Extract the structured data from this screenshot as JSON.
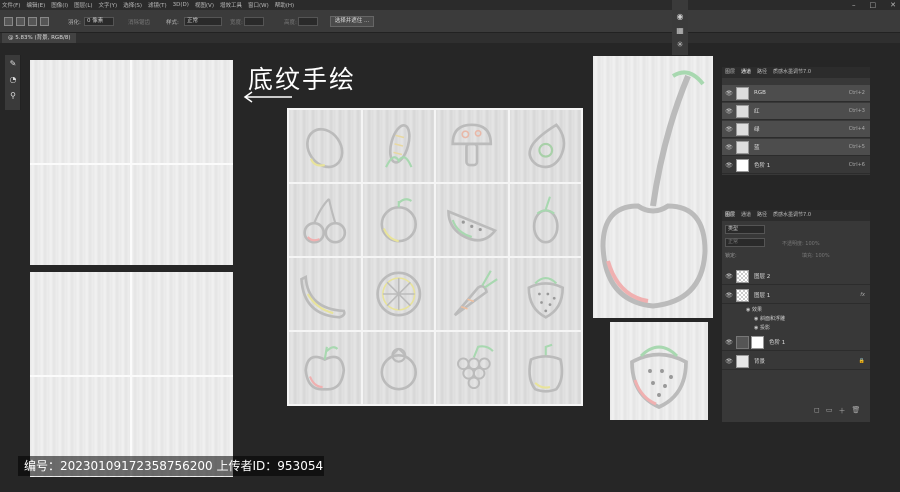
{
  "menubar": {
    "items": [
      "文件(F)",
      "编辑(E)",
      "图像(I)",
      "图层(L)",
      "文字(Y)",
      "选择(S)",
      "滤镜(T)",
      "3D(D)",
      "视图(V)",
      "增效工具",
      "窗口(W)",
      "帮助(H)"
    ]
  },
  "options": {
    "feather_label": "羽化:",
    "feather_value": "0 像素",
    "antialias_label": "消除锯齿",
    "style_label": "样式:",
    "style_value": "正常",
    "width_label": "宽度:",
    "height_label": "高度:",
    "select_subject": "选择并遮住 ..."
  },
  "document": {
    "tab": "@ 5.83% (背景, RGB/8)"
  },
  "canvas": {
    "title": "底纹手绘"
  },
  "channels_panel": {
    "tabs": [
      "图层",
      "通道",
      "路径",
      "质感水墨调节7.0"
    ],
    "rows": [
      {
        "name": "RGB",
        "shortcut": "Ctrl+2"
      },
      {
        "name": "红",
        "shortcut": "Ctrl+3"
      },
      {
        "name": "绿",
        "shortcut": "Ctrl+4"
      },
      {
        "name": "蓝",
        "shortcut": "Ctrl+5"
      },
      {
        "name": "色阶 1",
        "shortcut": "Ctrl+6"
      }
    ]
  },
  "layers_panel": {
    "tabs": [
      "图层",
      "通道",
      "路径",
      "质感水墨调节7.0"
    ],
    "filter_label": "类型",
    "blend_mode": "正常",
    "opacity_label": "不透明度: 100%",
    "lock_label": "锁定:",
    "fill_label": "填充: 100%",
    "layers": [
      {
        "name": "图层 2"
      },
      {
        "name": "图层 1",
        "fx": "fx"
      },
      {
        "name": "效果"
      },
      {
        "name": "斜面和浮雕"
      },
      {
        "name": "投影"
      },
      {
        "name": "色阶 1"
      },
      {
        "name": "背景"
      }
    ]
  },
  "watermark": {
    "text": "编号：20230109172358756200 上传者ID：953054"
  },
  "icons": [
    "lemon-icon",
    "corn-icon",
    "mushroom-icon",
    "avocado-icon",
    "cherry-icon",
    "orange-icon",
    "watermelon-icon",
    "eggplant-icon",
    "banana-icon",
    "citrus-slice-icon",
    "carrot-icon",
    "strawberry-icon",
    "apple-icon",
    "mangosteen-icon",
    "grape-icon",
    "pepper-icon"
  ]
}
